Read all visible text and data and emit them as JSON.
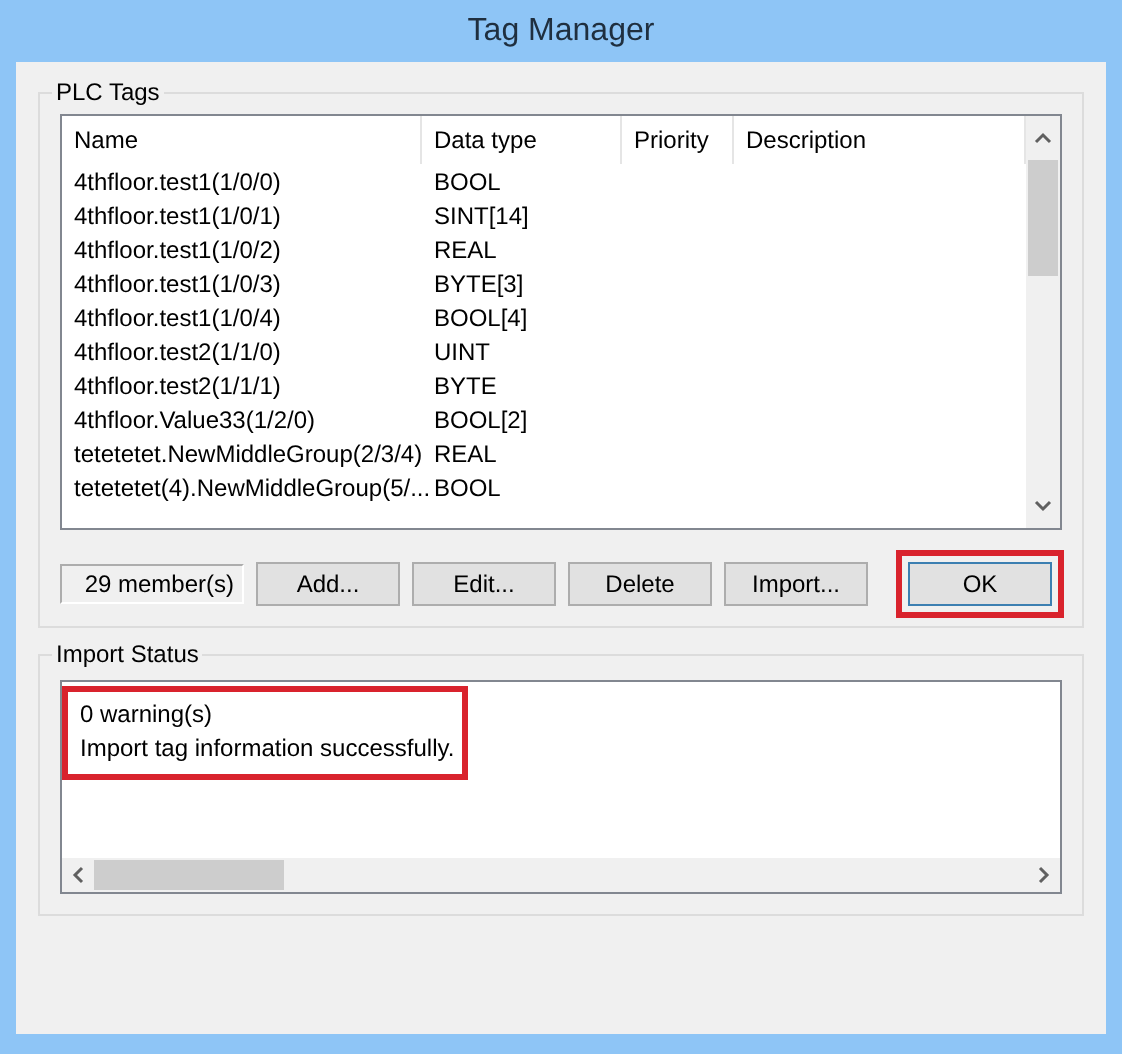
{
  "window": {
    "title": "Tag Manager"
  },
  "plc_tags": {
    "label": "PLC Tags",
    "columns": [
      "Name",
      "Data type",
      "Priority",
      "Description"
    ],
    "rows": [
      {
        "name": "4thfloor.test1(1/0/0)",
        "data_type": "BOOL"
      },
      {
        "name": "4thfloor.test1(1/0/1)",
        "data_type": "SINT[14]"
      },
      {
        "name": "4thfloor.test1(1/0/2)",
        "data_type": "REAL"
      },
      {
        "name": "4thfloor.test1(1/0/3)",
        "data_type": "BYTE[3]"
      },
      {
        "name": "4thfloor.test1(1/0/4)",
        "data_type": "BOOL[4]"
      },
      {
        "name": "4thfloor.test2(1/1/0)",
        "data_type": "UINT"
      },
      {
        "name": "4thfloor.test2(1/1/1)",
        "data_type": "BYTE"
      },
      {
        "name": "4thfloor.Value33(1/2/0)",
        "data_type": "BOOL[2]"
      },
      {
        "name": "tetetetet.NewMiddleGroup(2/3/4)",
        "data_type": "REAL"
      },
      {
        "name": "tetetetet(4).NewMiddleGroup(5/...",
        "data_type": "BOOL"
      }
    ],
    "member_count": "29 member(s)",
    "buttons": [
      {
        "label": "Add...",
        "default": false,
        "highlighted": false
      },
      {
        "label": "Edit...",
        "default": false,
        "highlighted": false
      },
      {
        "label": "Delete",
        "default": false,
        "highlighted": false
      },
      {
        "label": "Import...",
        "default": false,
        "highlighted": false
      },
      {
        "label": "OK",
        "default": true,
        "highlighted": true
      }
    ]
  },
  "import_status": {
    "label": "Import Status",
    "highlighted": true,
    "lines": [
      "0 warning(s)",
      "Import tag information successfully."
    ]
  }
}
